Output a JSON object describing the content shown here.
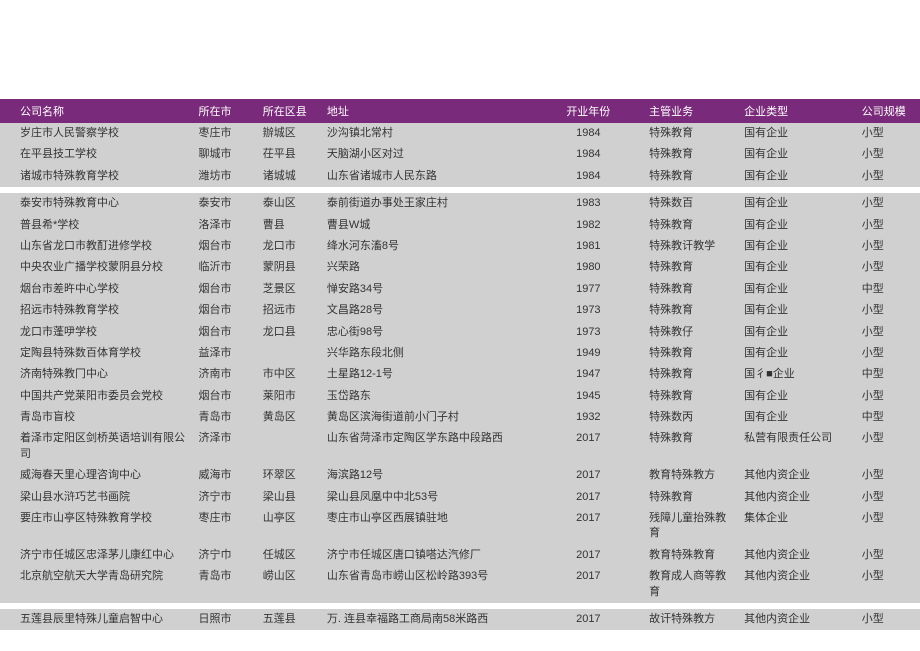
{
  "headers": {
    "name": "公司名称",
    "city": "所在市",
    "district": "所在区县",
    "address": "地址",
    "year": "开业年份",
    "business": "主管业务",
    "type": "企业类型",
    "scale": "公司规模"
  },
  "rows": [
    {
      "name": "岁庄市人民警察学校",
      "city": "枣庄市",
      "district": "辦城区",
      "address": "沙沟镇北常村",
      "year": "1984",
      "business": "特殊教育",
      "type": "国有企业",
      "scale": "小型"
    },
    {
      "name": "在平县技工学校",
      "city": "聊城市",
      "district": "茌平县",
      "address": "天脑湖小区对过",
      "year": "1984",
      "business": "特殊教育",
      "type": "国有企业",
      "scale": "小型"
    },
    {
      "name": "诸城市特殊教育学校",
      "city": "潍坊市",
      "district": "诸城城",
      "address": "山东省诸城市人民东路",
      "year": "1984",
      "business": "特殊教育",
      "type": "国有企业",
      "scale": "小型"
    },
    {
      "spacer": true
    },
    {
      "name": "泰安市特殊教育中心",
      "city": "泰安市",
      "district": "泰山区",
      "address": "泰前街道办事处王家庄村",
      "year": "1983",
      "business": "特殊数百",
      "type": "国有企业",
      "scale": "小型"
    },
    {
      "name": "普县希*学校",
      "city": "洛泽市",
      "district": "曹县",
      "address": "曹县W城",
      "year": "1982",
      "business": "特殊教育",
      "type": "国有企业",
      "scale": "小型"
    },
    {
      "name": "山东省龙口市教酊进修学校",
      "city": "烟台市",
      "district": "龙口市",
      "address": "绛水河东滀8号",
      "year": "1981",
      "business": "特殊教讦教学",
      "type": "国有企业",
      "scale": "小型"
    },
    {
      "name": "中央农业广播学校蒙阴县分校",
      "city": "临沂市",
      "district": "蒙阴县",
      "address": "兴荣路",
      "year": "1980",
      "business": "特殊教育",
      "type": "国有企业",
      "scale": "小型"
    },
    {
      "name": "烟台市差旿中心学校",
      "city": "烟台市",
      "district": "芝景区",
      "address": "惮安路34号",
      "year": "1977",
      "business": "特殊教育",
      "type": "国有企业",
      "scale": "中型"
    },
    {
      "name": "招远市特殊教育学校",
      "city": "烟台市",
      "district": "招远市",
      "address": "文昌路28号",
      "year": "1973",
      "business": "特殊教育",
      "type": "国有企业",
      "scale": "小型"
    },
    {
      "name": "龙口市蓬吚学校",
      "city": "烟台市",
      "district": "龙口县",
      "address": "忠心街98号",
      "year": "1973",
      "business": "特殊教仔",
      "type": "国有企业",
      "scale": "小型"
    },
    {
      "name": "定陶县特殊数百体育学校",
      "city": "益泽市",
      "district": "",
      "address": "兴华路东段北侧",
      "year": "1949",
      "business": "特殊教育",
      "type": "国有企业",
      "scale": "小型"
    },
    {
      "name": "济南特殊教冂中心",
      "city": "济南市",
      "district": "市中区",
      "address": "土星路12-1号",
      "year": "1947",
      "business": "特殊教育",
      "type": "国彳■企业",
      "scale": "中型"
    },
    {
      "name": "中国共产党莱阳市委员会党校",
      "city": "烟台市",
      "district": "莱阳市",
      "address": "玉岱路东",
      "year": "1945",
      "business": "特殊教育",
      "type": "国有企业",
      "scale": "小型"
    },
    {
      "name": "青岛市盲校",
      "city": "青岛市",
      "district": "黄岛区",
      "address": "黄岛区滨海街道前小门子村",
      "year": "1932",
      "business": "特殊数丙",
      "type": "国有企业",
      "scale": "中型"
    },
    {
      "name": "着泽市定阳区剑桥英语培训有限公司",
      "city": "济泽市",
      "district": "",
      "address": "山东省菏泽市定陶区学东路中段路西",
      "year": "2017",
      "business": "  特殊教育",
      "type": "私营有限责任公司",
      "scale": "小型"
    },
    {
      "name": "威海春天里心理咨询中心",
      "city": "威海市",
      "district": "环翠区",
      "address": "海滨路12号",
      "year": "2017",
      "business": "教育特殊教方",
      "type": "其他内资企业",
      "scale": "小型"
    },
    {
      "name": "梁山县水浒巧艺书画院",
      "city": "济宁市",
      "district": "梁山县",
      "address": "梁山县凤凰中中北53号",
      "year": "2017",
      "business": "  特殊教育",
      "type": "其他内资企业",
      "scale": "小型"
    },
    {
      "name": "要庄市山亭区特殊教育学校",
      "city": "枣庄市",
      "district": "山亭区",
      "address": "枣庄市山亭区西展镇驻地",
      "year": "2017",
      "business": "   残障儿童抬殊教育",
      "type": "集体企业",
      "scale": "小型"
    },
    {
      "name": "济宁市任城区忠泽茅儿康红中心",
      "city": "济宁巾",
      "district": "任城区",
      "address": "济宁市任城区唐口镇嗒达汽修厂",
      "year": "2017",
      "business": "教育特殊教育",
      "type": "其他内资企业",
      "scale": "小型"
    },
    {
      "name": "北京航空航天大学青岛研究院",
      "city": "青岛市",
      "district": "崂山区",
      "address": "山东省青岛市崂山区松岭路393号",
      "year": "2017",
      "business": "教育成人商等教育",
      "type": "其他内资企业",
      "scale": "小型"
    },
    {
      "spacer": true
    },
    {
      "name": "五莲县辰里特殊儿童启智中心",
      "city": "日照市",
      "district": "五莲县",
      "address": "万. 连县幸福路工商局南58米路西",
      "year": "2017",
      "business": "故讦特殊教方",
      "type": "其他内资企业",
      "scale": "小型"
    }
  ]
}
